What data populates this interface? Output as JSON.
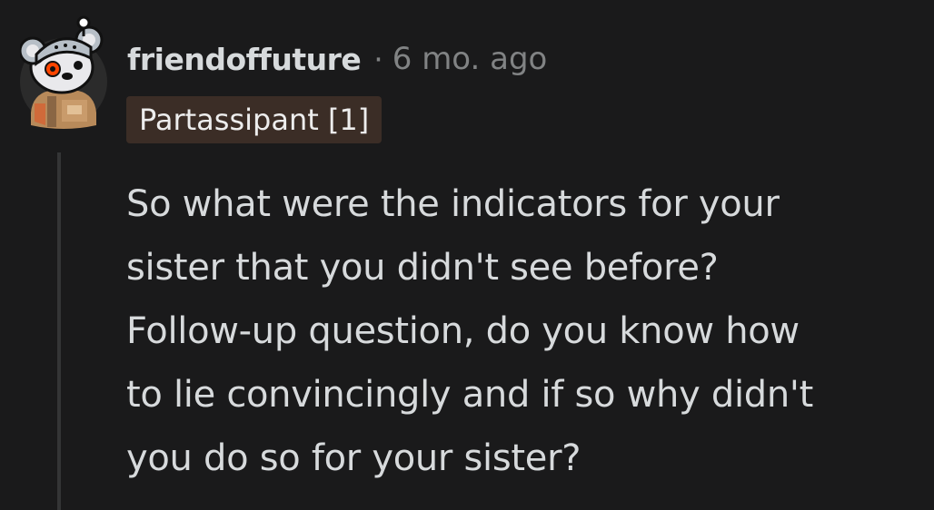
{
  "comment": {
    "username": "friendoffuture",
    "separator": "·",
    "timestamp": "6 mo. ago",
    "flair": "Partassipant [1]",
    "body_lines": [
      "So what were the indicators for your",
      "sister that you didn't see before?",
      "Follow-up question, do you know how",
      "to lie convincingly and if so why didn't",
      "you do so for your sister?"
    ]
  }
}
